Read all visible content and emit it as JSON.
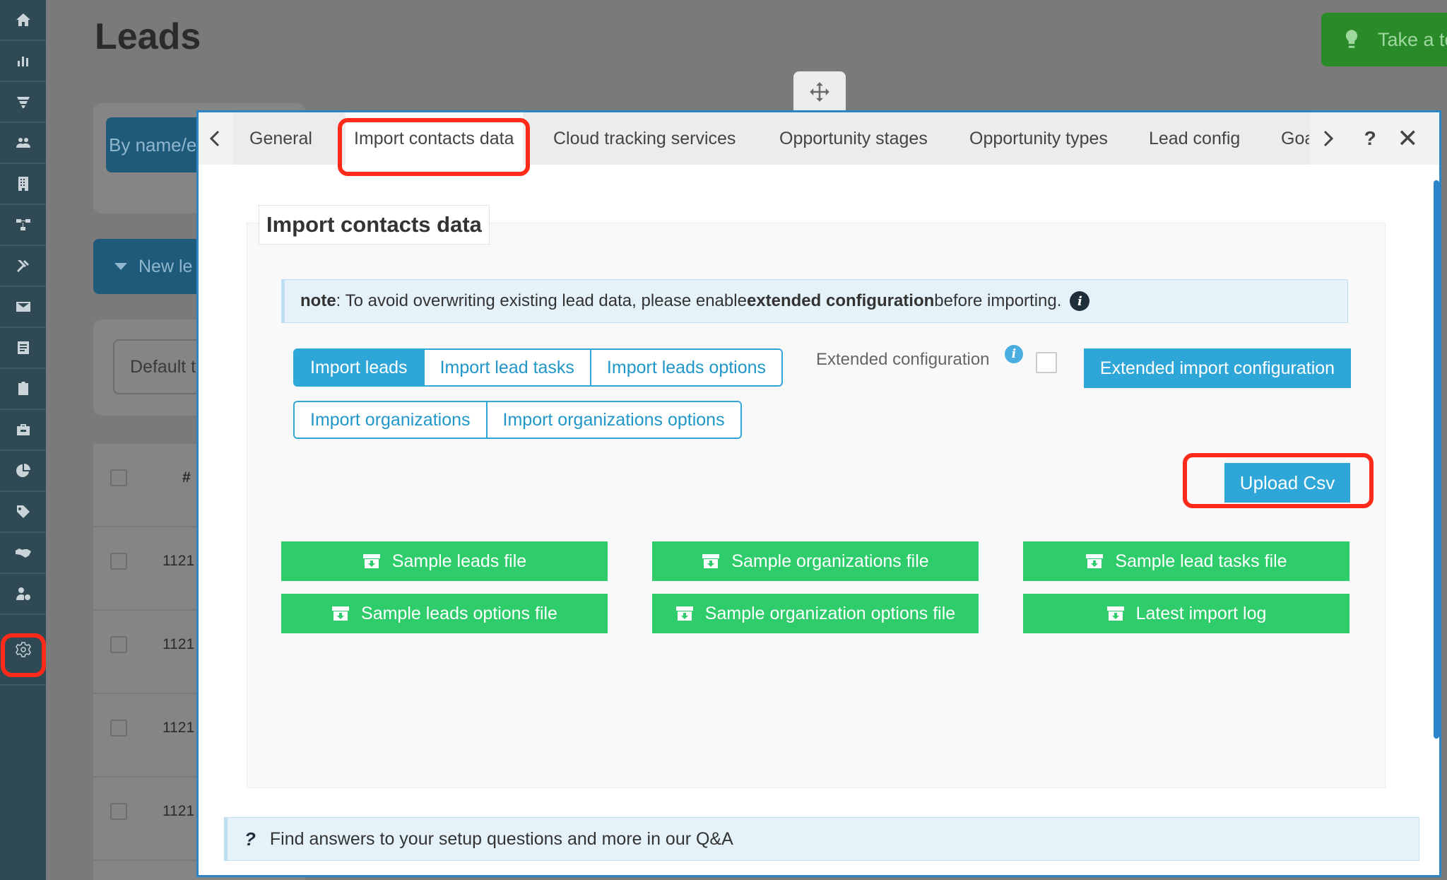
{
  "background": {
    "page_title": "Leads",
    "tour_button": "Take a to",
    "search_button": "By name/e",
    "new_lead_button": "New le",
    "default_filter": "Default t",
    "table_header_hash": "#",
    "rows": [
      "1121",
      "1121",
      "1121",
      "1121"
    ]
  },
  "sidebar": {
    "icons": [
      "home-icon",
      "chart-icon",
      "funnel-icon",
      "users-icon",
      "building-icon",
      "flow-icon",
      "tools-icon",
      "mail-icon",
      "document-icon",
      "clipboard-icon",
      "briefcase-icon",
      "pie-chart-icon",
      "tag-icon",
      "handshake-icon",
      "user-settings-icon",
      "gear-icon"
    ]
  },
  "modal": {
    "tabs": [
      "General",
      "Import contacts data",
      "Cloud tracking services",
      "Opportunity stages",
      "Opportunity types",
      "Lead config",
      "Goa"
    ],
    "help": "?",
    "close": "✕",
    "section_title": "Import contacts data",
    "note": {
      "prefix": "note",
      "text1": ": To avoid overwriting existing lead data, please enable ",
      "bold": "extended configuration",
      "text2": " before importing.",
      "info": "i"
    },
    "import_group_1": [
      "Import leads",
      "Import lead tasks",
      "Import leads options"
    ],
    "import_group_2": [
      "Import organizations",
      "Import organizations options"
    ],
    "extended_label": "Extended configuration",
    "extended_info": "i",
    "extended_button": "Extended import configuration",
    "upload_button": "Upload Csv",
    "samples": [
      "Sample leads file",
      "Sample organizations file",
      "Sample lead tasks file",
      "Sample leads options file",
      "Sample organization options file",
      "Latest import log"
    ],
    "qa_icon": "?",
    "qa_text": "Find answers to your setup questions and more in our Q&A"
  },
  "colors": {
    "primary": "#2fa6d8",
    "success": "#2ecc6a",
    "highlight": "#ff2a1a",
    "sidebar": "#2f4a55"
  }
}
